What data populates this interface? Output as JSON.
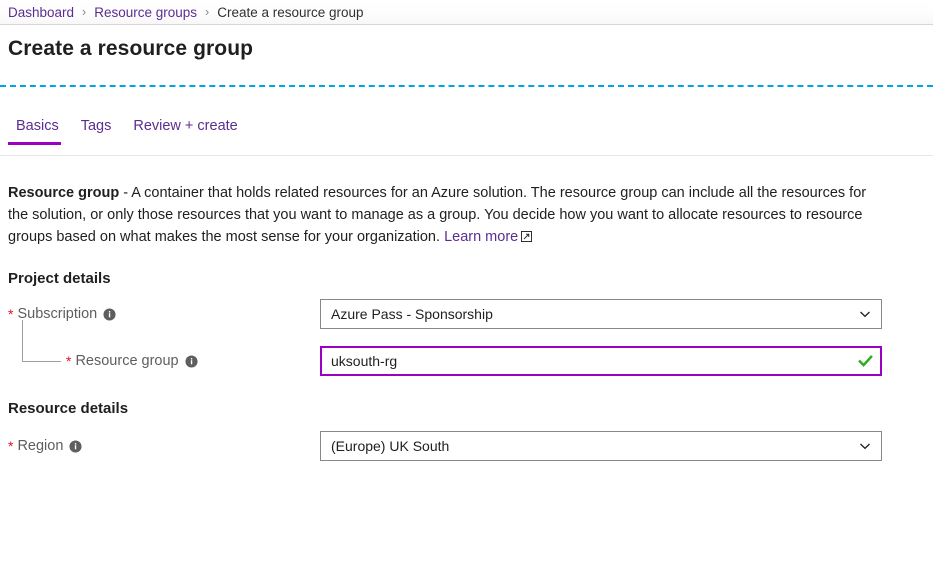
{
  "breadcrumb": {
    "items": [
      {
        "label": "Dashboard",
        "current": false
      },
      {
        "label": "Resource groups",
        "current": false
      },
      {
        "label": "Create a resource group",
        "current": true
      }
    ],
    "separator": "›"
  },
  "header": {
    "title": "Create a resource group"
  },
  "tabs": [
    {
      "label": "Basics",
      "active": true
    },
    {
      "label": "Tags",
      "active": false
    },
    {
      "label": "Review + create",
      "active": false
    }
  ],
  "description": {
    "lead": "Resource group",
    "body": " - A container that holds related resources for an Azure solution. The resource group can include all the resources for the solution, or only those resources that you want to manage as a group. You decide how you want to allocate resources to resource groups based on what makes the most sense for your organization. ",
    "link_label": "Learn more",
    "link_icon": "external-link-icon"
  },
  "project_details": {
    "heading": "Project details",
    "subscription": {
      "label": "Subscription",
      "required_marker": "*",
      "info_icon": "info-icon",
      "value": "Azure Pass - Sponsorship",
      "chevron_icon": "chevron-down-icon"
    },
    "resource_group": {
      "label": "Resource group",
      "required_marker": "*",
      "info_icon": "info-icon",
      "value": "uksouth-rg",
      "placeholder": "",
      "validation_icon": "check-icon",
      "validation_color": "#2fab1f"
    }
  },
  "resource_details": {
    "heading": "Resource details",
    "region": {
      "label": "Region",
      "required_marker": "*",
      "info_icon": "info-icon",
      "value": "(Europe) UK South",
      "chevron_icon": "chevron-down-icon"
    }
  },
  "colors": {
    "accent_purple": "#9b00c4",
    "link_purple": "#5c2d91",
    "required_red": "#e81123",
    "valid_green": "#2fab1f",
    "focus_blue": "#00a2e8"
  }
}
